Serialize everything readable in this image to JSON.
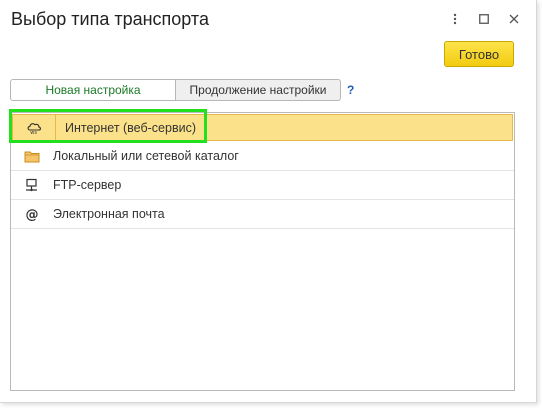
{
  "window": {
    "title": "Выбор типа транспорта",
    "menu_icon": "more-vert-icon",
    "maximize_icon": "maximize-icon",
    "close_icon": "close-icon"
  },
  "toolbar": {
    "ready_label": "Готово",
    "ready_color": "#f5d21c"
  },
  "tabs": [
    {
      "label": "Новая настройка",
      "active": true,
      "color": "#1a7a28"
    },
    {
      "label": "Продолжение настройки",
      "active": false
    }
  ],
  "help_label": "?",
  "transport_list": [
    {
      "label": "Интернет (веб-сервис)",
      "icon": "cloud-ws-icon",
      "selected": true
    },
    {
      "label": "Локальный или сетевой каталог",
      "icon": "folder-icon",
      "selected": false
    },
    {
      "label": "FTP-сервер",
      "icon": "ftp-server-icon",
      "selected": false
    },
    {
      "label": "Электронная почта",
      "icon": "at-sign-icon",
      "selected": false
    }
  ],
  "colors": {
    "selection_bg": "#fbe28a",
    "highlight_outline": "#22e01e",
    "help_link": "#1f5fb5"
  }
}
